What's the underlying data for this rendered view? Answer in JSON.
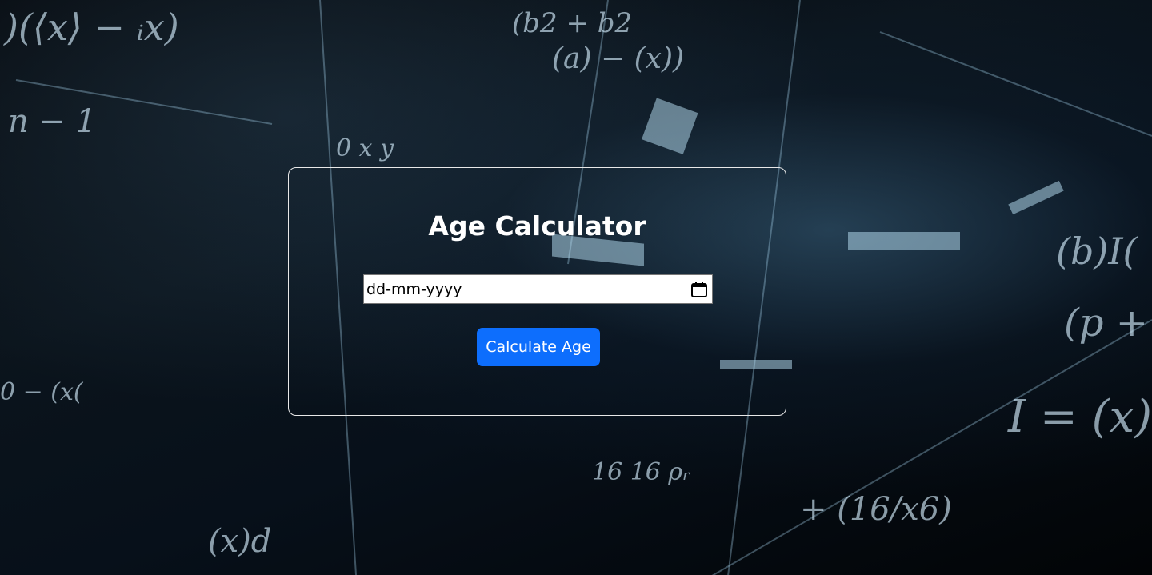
{
  "app": {
    "title": "Age Calculator"
  },
  "form": {
    "date_placeholder": "dd-mm-yyyy",
    "calculate_label": "Calculate Age"
  },
  "colors": {
    "button": "#0d6efd",
    "card_border": "#e8e8e8",
    "text": "#ffffff"
  },
  "icons": {
    "date_picker": "calendar-icon"
  }
}
